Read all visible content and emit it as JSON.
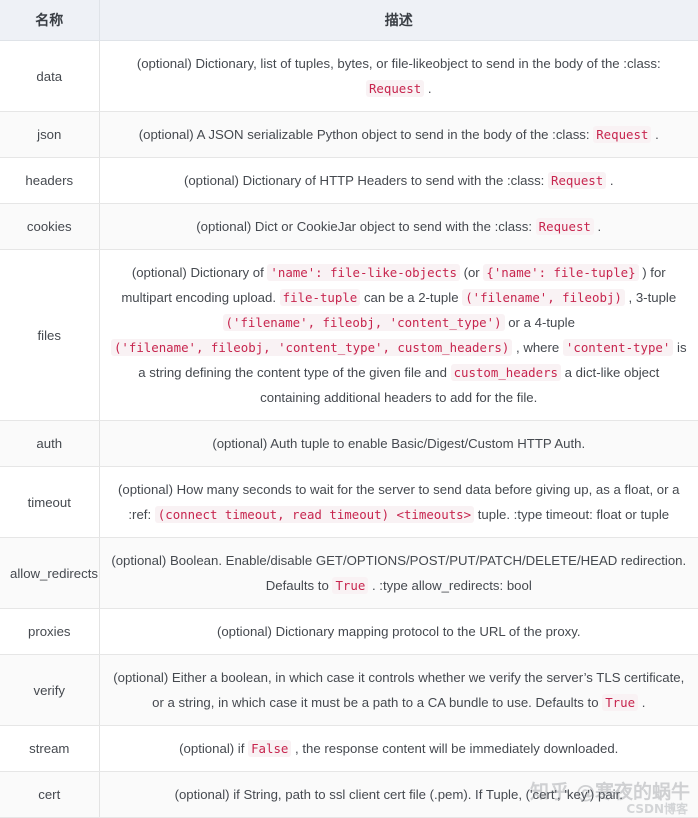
{
  "table": {
    "columns": [
      {
        "key": "name",
        "label": "名称"
      },
      {
        "key": "desc",
        "label": "描述"
      }
    ],
    "rows": [
      {
        "name": "data",
        "desc_parts": [
          {
            "t": "text",
            "v": "(optional) Dictionary, list of tuples, bytes, or file-likeobject to send in the body of the :class: "
          },
          {
            "t": "code",
            "v": "Request"
          },
          {
            "t": "text",
            "v": " ."
          }
        ]
      },
      {
        "name": "json",
        "desc_parts": [
          {
            "t": "text",
            "v": "(optional) A JSON serializable Python object to send in the body of the :class: "
          },
          {
            "t": "code",
            "v": "Request"
          },
          {
            "t": "text",
            "v": " ."
          }
        ]
      },
      {
        "name": "headers",
        "desc_parts": [
          {
            "t": "text",
            "v": "(optional) Dictionary of HTTP Headers to send with the :class: "
          },
          {
            "t": "code",
            "v": "Request"
          },
          {
            "t": "text",
            "v": " ."
          }
        ]
      },
      {
        "name": "cookies",
        "desc_parts": [
          {
            "t": "text",
            "v": "(optional) Dict or CookieJar object to send with the :class: "
          },
          {
            "t": "code",
            "v": "Request"
          },
          {
            "t": "text",
            "v": " ."
          }
        ]
      },
      {
        "name": "files",
        "desc_parts": [
          {
            "t": "text",
            "v": "(optional) Dictionary of "
          },
          {
            "t": "code",
            "v": "'name': file-like-objects"
          },
          {
            "t": "text",
            "v": " (or "
          },
          {
            "t": "code",
            "v": "{'name': file-tuple}"
          },
          {
            "t": "text",
            "v": " ) for multipart encoding upload. "
          },
          {
            "t": "code",
            "v": "file-tuple"
          },
          {
            "t": "text",
            "v": " can be a 2-tuple "
          },
          {
            "t": "code",
            "v": "('filename', fileobj)"
          },
          {
            "t": "text",
            "v": " , 3-tuple "
          },
          {
            "t": "code",
            "v": "('filename', fileobj, 'content_type')"
          },
          {
            "t": "text",
            "v": " or a 4-tuple "
          },
          {
            "t": "code",
            "v": "('filename', fileobj, 'content_type', custom_headers)"
          },
          {
            "t": "text",
            "v": " , where "
          },
          {
            "t": "code",
            "v": "'content-type'"
          },
          {
            "t": "text",
            "v": " is a string defining the content type of the given file and "
          },
          {
            "t": "code",
            "v": "custom_headers"
          },
          {
            "t": "text",
            "v": " a dict-like object containing additional headers to add for the file."
          }
        ]
      },
      {
        "name": "auth",
        "desc_parts": [
          {
            "t": "text",
            "v": "(optional) Auth tuple to enable Basic/Digest/Custom HTTP Auth."
          }
        ]
      },
      {
        "name": "timeout",
        "desc_parts": [
          {
            "t": "text",
            "v": "(optional) How many seconds to wait for the server to send data before giving up, as a float, or a :ref: "
          },
          {
            "t": "code",
            "v": "(connect timeout, read timeout) <timeouts>"
          },
          {
            "t": "text",
            "v": " tuple. :type timeout: float or tuple"
          }
        ]
      },
      {
        "name": "allow_redirects",
        "desc_parts": [
          {
            "t": "text",
            "v": "(optional) Boolean. Enable/disable GET/OPTIONS/POST/PUT/PATCH/DELETE/HEAD redirection. Defaults to "
          },
          {
            "t": "code",
            "v": "True"
          },
          {
            "t": "text",
            "v": " . :type allow_redirects: bool"
          }
        ]
      },
      {
        "name": "proxies",
        "desc_parts": [
          {
            "t": "text",
            "v": "(optional) Dictionary mapping protocol to the URL of the proxy."
          }
        ]
      },
      {
        "name": "verify",
        "desc_parts": [
          {
            "t": "text",
            "v": "(optional) Either a boolean, in which case it controls whether we verify the server’s TLS certificate, or a string, in which case it must be a path to a CA bundle to use. Defaults to "
          },
          {
            "t": "code",
            "v": "True"
          },
          {
            "t": "text",
            "v": " ."
          }
        ]
      },
      {
        "name": "stream",
        "desc_parts": [
          {
            "t": "text",
            "v": "(optional) if "
          },
          {
            "t": "code",
            "v": "False"
          },
          {
            "t": "text",
            "v": " , the response content will be immediately downloaded."
          }
        ]
      },
      {
        "name": "cert",
        "desc_parts": [
          {
            "t": "text",
            "v": "(optional) if String, path to ssl client cert file (.pem). If Tuple, ('cert', 'key') pair."
          }
        ]
      }
    ]
  },
  "watermark": {
    "logo": "知乎",
    "user": "@寒夜的蜗牛",
    "sub": "CSDN博客"
  },
  "colors": {
    "code_text": "#c7254e",
    "code_background": "#f9f2f4",
    "header_background": "#eef1f6",
    "row_stripe": "#fafafa",
    "border": "#e6e6e6",
    "text": "#45494f"
  }
}
